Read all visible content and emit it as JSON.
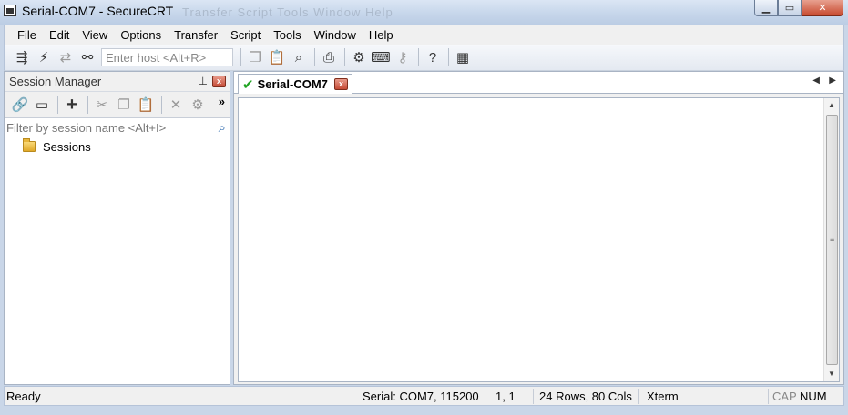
{
  "window": {
    "title": "Serial-COM7 - SecureCRT",
    "ghost_menu": "Transfer  Script  Tools  Window  Help",
    "min_glyph": "▁",
    "max_glyph": "▭",
    "close_glyph": "✕"
  },
  "menu": [
    "File",
    "Edit",
    "View",
    "Options",
    "Transfer",
    "Script",
    "Tools",
    "Window",
    "Help"
  ],
  "toolbar": {
    "host_placeholder": "Enter host <Alt+R>",
    "icons": {
      "connect": "⇶",
      "quick_connect": "⚡",
      "reconnect": "⇄",
      "disconnect": "⚯",
      "copy": "❐",
      "paste": "📋",
      "find": "⌕",
      "print": "⎙",
      "settings": "⚙",
      "keymap": "⌨",
      "key": "⚷",
      "help": "?",
      "sftp": "▦"
    }
  },
  "session_manager": {
    "title": "Session Manager",
    "pin_glyph": "⊥",
    "close_glyph": "x",
    "more_glyph": "»",
    "filter_placeholder": "Filter by session name <Alt+I>",
    "tree": [
      {
        "label": "Sessions",
        "icon": "folder-icon"
      }
    ],
    "toolbar_icons": {
      "link": "🔗",
      "window": "▭",
      "add": "+",
      "cut": "✂",
      "copy": "❐",
      "paste": "📋",
      "delete": "✕",
      "properties": "⚙"
    }
  },
  "tab": {
    "label": "Serial-COM7",
    "status_glyph": "✔",
    "close_glyph": "x",
    "prev_glyph": "◀",
    "next_glyph": "▶"
  },
  "scrollbar": {
    "up": "▲",
    "down": "▼",
    "grip": "≡"
  },
  "status": {
    "ready": "Ready",
    "connection": "Serial: COM7, 115200",
    "cursor": "1,   1",
    "size": "24 Rows, 80 Cols",
    "terminal": "Xterm",
    "cap": "CAP",
    "num": "NUM"
  }
}
